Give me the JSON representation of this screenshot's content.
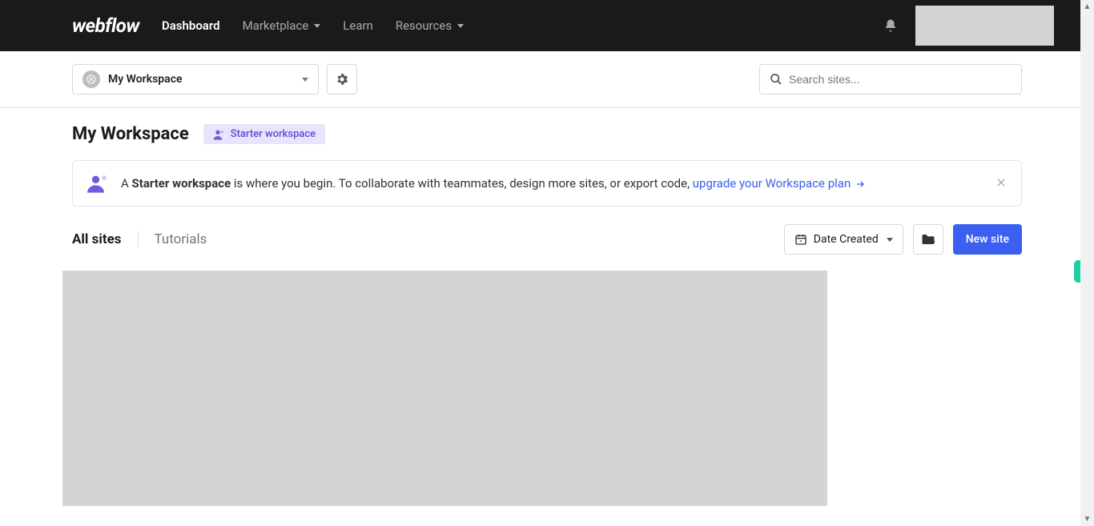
{
  "nav": {
    "logo": "webflow",
    "items": [
      "Dashboard",
      "Marketplace",
      "Learn",
      "Resources"
    ]
  },
  "workspace": {
    "selected": "My Workspace"
  },
  "search": {
    "placeholder": "Search sites..."
  },
  "header": {
    "title": "My Workspace",
    "badge": "Starter workspace"
  },
  "banner": {
    "prefix": "A ",
    "strong": "Starter workspace",
    "mid": " is where you begin. To collaborate with teammates, design more sites, or export code, ",
    "link": "upgrade your Workspace plan"
  },
  "tabs": {
    "allsites": "All sites",
    "tutorials": "Tutorials"
  },
  "sort": {
    "label": "Date Created"
  },
  "actions": {
    "newSite": "New site"
  }
}
